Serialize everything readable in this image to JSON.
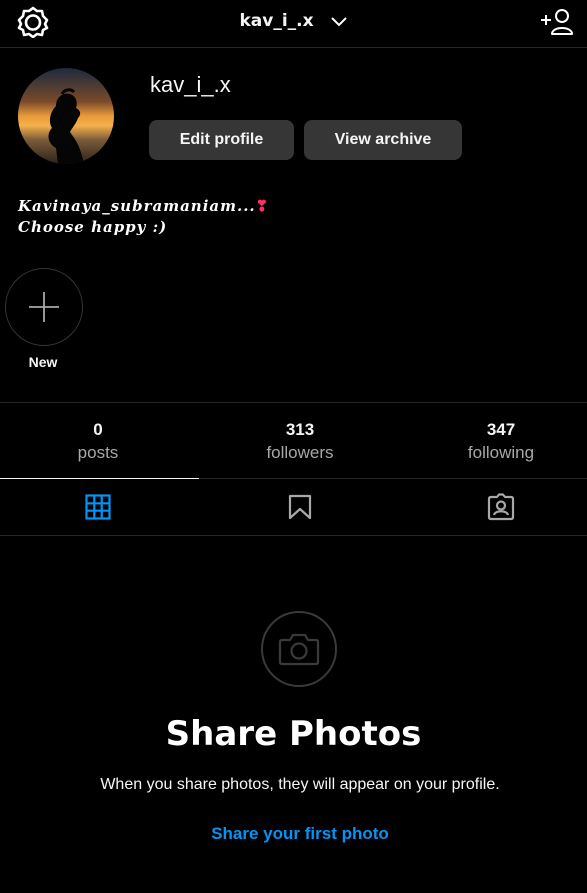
{
  "header": {
    "username": "kav_i_.x",
    "settings_icon": "gear-icon",
    "chevron_icon": "chevron-down-icon",
    "add_user_icon": "add-user-icon"
  },
  "profile": {
    "username": "kav_i_.x",
    "edit_profile_label": "Edit profile",
    "view_archive_label": "View archive",
    "bio_line1": "Kavinaya_subramaniam...",
    "bio_heart": "❣",
    "bio_line2": "Choose happy :)"
  },
  "highlights": {
    "new_label": "New"
  },
  "stats": {
    "posts_count": "0",
    "posts_label": "posts",
    "followers_count": "313",
    "followers_label": "followers",
    "following_count": "347",
    "following_label": "following"
  },
  "tabs": {
    "active": "grid",
    "items": [
      "grid-icon",
      "bookmark-icon",
      "tagged-icon"
    ]
  },
  "empty_state": {
    "title": "Share Photos",
    "subtitle": "When you share photos, they will appear on your profile.",
    "link": "Share your first photo"
  },
  "colors": {
    "background": "#000000",
    "button": "#363636",
    "link": "#0095f6",
    "active_tab": "#0095f6",
    "muted": "#a8a8a8"
  }
}
